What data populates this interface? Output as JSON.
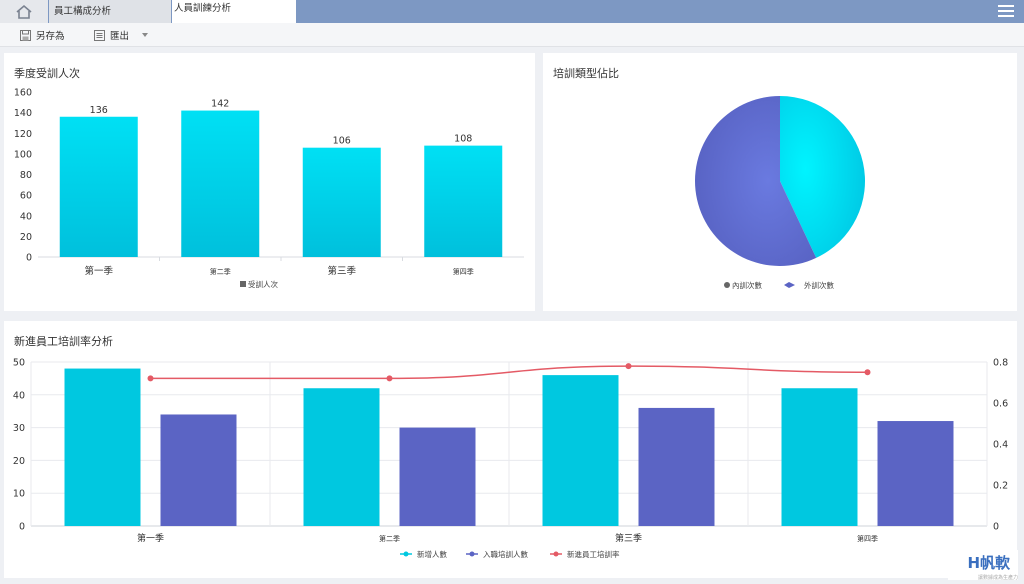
{
  "tabs": [
    {
      "label": "員工構成分析"
    },
    {
      "label": "人員訓練分析"
    }
  ],
  "toolbar": {
    "save_as": "另存為",
    "export": "匯出"
  },
  "colors": {
    "cyan": "#00c8e0",
    "indigo": "#5b64c4",
    "red": "#e45a65",
    "topbar": "#7d98c3"
  },
  "charts": {
    "quarterly": {
      "title": "季度受訓人次",
      "legend": "受訓人次"
    },
    "pie": {
      "title": "培訓類型佔比",
      "legend": [
        "內訓次數",
        "外訓次數"
      ]
    },
    "combo": {
      "title": "新進員工培訓率分析",
      "legend": [
        "新增人數",
        "入職培訓人數",
        "新進員工培訓率"
      ]
    }
  },
  "chart_data": [
    {
      "type": "bar",
      "title": "季度受訓人次",
      "categories": [
        "第一季",
        "第二季",
        "第三季",
        "第四季"
      ],
      "series": [
        {
          "name": "受訓人次",
          "values": [
            136,
            142,
            106,
            108
          ]
        }
      ],
      "ylim": [
        0,
        160
      ],
      "yticks": [
        0,
        20,
        40,
        60,
        80,
        100,
        120,
        140,
        160
      ],
      "legend_position": "bottom",
      "grid": false
    },
    {
      "type": "pie",
      "title": "培訓類型佔比",
      "labels": [
        "內訓次數",
        "外訓次數"
      ],
      "values": [
        43,
        57
      ],
      "colors": [
        "#00d8ee",
        "#5b64c4"
      ],
      "legend_position": "bottom"
    },
    {
      "type": "bar",
      "title": "新進員工培訓率分析",
      "categories": [
        "第一季",
        "第二季",
        "第三季",
        "第四季"
      ],
      "series": [
        {
          "name": "新增人數",
          "type": "bar",
          "values": [
            48,
            42,
            46,
            42
          ]
        },
        {
          "name": "入職培訓人數",
          "type": "bar",
          "values": [
            34,
            30,
            36,
            32
          ]
        },
        {
          "name": "新進員工培訓率",
          "type": "line",
          "axis": "right",
          "values": [
            0.72,
            0.72,
            0.78,
            0.75
          ]
        }
      ],
      "ylim": [
        0,
        50
      ],
      "yticks": [
        0,
        10,
        20,
        30,
        40,
        50
      ],
      "y2lim": [
        0,
        0.8
      ],
      "y2ticks": [
        0,
        0.2,
        0.4,
        0.6,
        0.8
      ],
      "legend_position": "bottom",
      "grid": true
    }
  ],
  "brand": {
    "name": "H帆軟",
    "tagline": "讓數據成為生產力"
  }
}
